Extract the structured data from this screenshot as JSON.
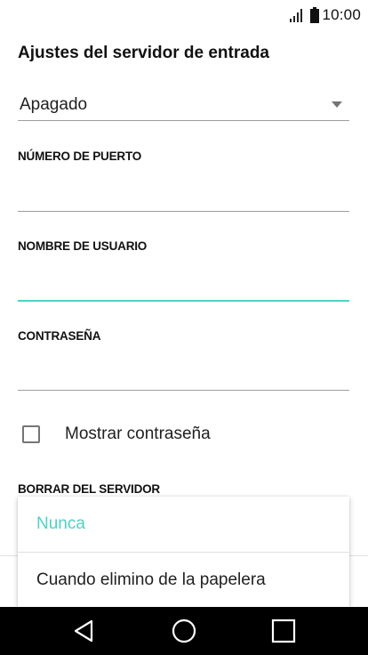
{
  "status_bar": {
    "time": "10:00",
    "icons": [
      "signal-icon",
      "battery-icon"
    ]
  },
  "app_bar": {
    "title": "Ajustes del servidor de entrada"
  },
  "security_dropdown": {
    "value": "Apagado"
  },
  "port_field": {
    "label": "NÚMERO DE PUERTO",
    "value": ""
  },
  "username_field": {
    "label": "NOMBRE DE USUARIO",
    "value": ""
  },
  "password_field": {
    "label": "CONTRASEÑA",
    "value": ""
  },
  "show_password": {
    "label": "Mostrar contraseña",
    "checked": false
  },
  "delete_from_server": {
    "label": "BORRAR DEL SERVIDOR",
    "options": [
      {
        "label": "Nunca",
        "selected": true
      },
      {
        "label": "Cuando elimino de la papelera",
        "selected": false
      }
    ]
  },
  "nav_bar": {
    "icons": [
      "back-icon",
      "home-icon",
      "recents-icon"
    ]
  },
  "colors": {
    "accent": "#4fd1c5",
    "text": "#212121",
    "nav_background": "#000000"
  }
}
